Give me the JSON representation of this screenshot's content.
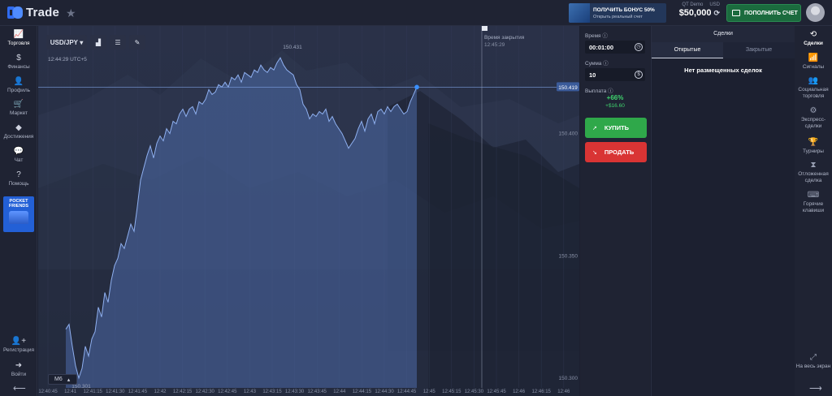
{
  "header": {
    "logo_text": "Trade",
    "bonus_title": "ПОЛУЧИТЬ БОНУС 50%",
    "bonus_subtitle": "Открыть реальный счет",
    "account_type": "QT Demo",
    "currency": "USD",
    "balance": "$50,000",
    "deposit_label": "ПОПОЛНИТЬ СЧЕТ"
  },
  "left_nav": [
    {
      "icon": "📈",
      "label": "Торговля",
      "active": true
    },
    {
      "icon": "$",
      "label": "Финансы"
    },
    {
      "icon": "👤",
      "label": "Профиль"
    },
    {
      "icon": "🛒",
      "label": "Маркет"
    },
    {
      "icon": "◆",
      "label": "Достижения"
    },
    {
      "icon": "💬",
      "label": "Чат"
    },
    {
      "icon": "?",
      "label": "Помощь"
    }
  ],
  "promo": {
    "line1": "POCKET",
    "line2": "FRIENDS"
  },
  "left_bottom": [
    {
      "icon": "👤+",
      "label": "Регистрация"
    },
    {
      "icon": "➜",
      "label": "Войти"
    }
  ],
  "chart": {
    "pair": "USD/JPY",
    "current_time": "12:44:29 UTC+5",
    "close_label": "Время закрытия",
    "close_time": "12:45:29",
    "timeframe": "M6",
    "high_label": "150.431",
    "low_label": "150.301",
    "current_price": "150.419"
  },
  "chart_data": {
    "type": "area",
    "x_ticks": [
      "12:40:45",
      "12:41",
      "12:41:15",
      "12:41:30",
      "12:41:45",
      "12:42",
      "12:42:15",
      "12:42:30",
      "12:42:45",
      "12:43",
      "12:43:15",
      "12:43:30",
      "12:43:45",
      "12:44",
      "12:44:15",
      "12:44:30",
      "12:44:45",
      "12:45",
      "12:45:15",
      "12:45:30",
      "12:45:45",
      "12:46",
      "12:46:15",
      "12:46"
    ],
    "y_ticks": [
      "150.400",
      "150.350",
      "150.300"
    ],
    "ylim": [
      150.296,
      150.444
    ],
    "x": [
      0,
      4,
      8,
      12,
      16,
      20,
      24,
      28,
      32,
      36,
      40,
      44,
      48,
      52,
      56,
      60,
      64,
      68,
      72,
      76,
      80,
      84,
      88,
      92,
      96,
      100,
      104,
      108,
      112,
      116,
      120,
      124,
      128,
      132,
      136,
      140,
      144,
      148,
      152,
      156,
      160,
      164,
      168,
      172,
      176,
      180,
      184,
      188,
      192,
      196,
      200,
      204,
      208,
      212,
      216,
      220,
      224,
      228,
      232,
      236,
      240,
      244,
      248,
      252,
      256,
      260,
      264,
      268,
      272,
      276,
      280,
      284,
      288,
      292,
      296,
      300,
      304,
      308,
      312,
      316,
      320,
      324,
      328,
      332,
      336,
      340,
      344,
      348,
      352,
      356,
      360,
      364,
      368,
      372,
      376,
      380,
      384,
      388,
      392,
      396,
      400,
      404,
      408,
      412,
      416,
      420,
      424,
      428,
      432
    ],
    "values": [
      150.32,
      150.322,
      150.313,
      150.305,
      150.3,
      150.304,
      150.313,
      150.309,
      150.316,
      150.319,
      150.329,
      150.325,
      150.335,
      150.331,
      150.34,
      150.346,
      150.349,
      150.355,
      150.353,
      150.358,
      150.363,
      150.36,
      150.37,
      150.381,
      150.386,
      150.391,
      150.395,
      150.39,
      150.396,
      150.399,
      150.397,
      150.402,
      150.4,
      150.405,
      150.404,
      150.408,
      150.41,
      150.407,
      150.41,
      150.411,
      150.408,
      150.413,
      150.412,
      150.414,
      150.418,
      150.416,
      150.417,
      150.42,
      150.419,
      150.421,
      150.419,
      150.423,
      150.422,
      150.424,
      150.421,
      150.425,
      150.424,
      150.423,
      150.426,
      150.425,
      150.428,
      150.426,
      150.425,
      150.427,
      150.426,
      150.429,
      150.431,
      150.428,
      150.426,
      150.425,
      150.424,
      150.42,
      150.418,
      150.412,
      150.41,
      150.406,
      150.408,
      150.407,
      150.409,
      150.408,
      150.41,
      150.405,
      150.407,
      150.404,
      150.402,
      150.4,
      150.397,
      150.394,
      150.396,
      150.398,
      150.402,
      150.405,
      150.401,
      150.406,
      150.408,
      150.404,
      150.409,
      150.41,
      150.408,
      150.411,
      150.409,
      150.411,
      150.412,
      150.41,
      150.408,
      150.409,
      150.413,
      150.416,
      150.419
    ]
  },
  "trade_panel": {
    "time_label": "Время",
    "time_value": "00:01:00",
    "amount_label": "Сумма",
    "amount_value": "10",
    "payout_label": "Выплата",
    "payout_percent": "+66%",
    "payout_amount": "+$16.60",
    "buy_label": "КУПИТЬ",
    "sell_label": "ПРОДАТЬ"
  },
  "deals": {
    "title": "Сделки",
    "tab_open": "Открытые",
    "tab_closed": "Закрытые",
    "empty_text": "Нет размещенных сделок"
  },
  "right_nav": [
    {
      "icon": "⟲",
      "label": "Сделки",
      "active": true
    },
    {
      "icon": "📶",
      "label": "Сигналы"
    },
    {
      "icon": "👥",
      "label": "Социальная торговля"
    },
    {
      "icon": "⚙",
      "label": "Экспресс-сделки"
    },
    {
      "icon": "🏆",
      "label": "Турниры"
    },
    {
      "icon": "⧗",
      "label": "Отложенная сделка"
    },
    {
      "icon": "⌨",
      "label": "Горячие клавиши"
    }
  ],
  "right_bottom": {
    "icon": "⤢",
    "label": "На весь экран"
  },
  "colors": {
    "accent_blue": "#2360d6",
    "buy": "#2fa84a",
    "sell": "#d93434",
    "payout": "#3fd46e"
  }
}
